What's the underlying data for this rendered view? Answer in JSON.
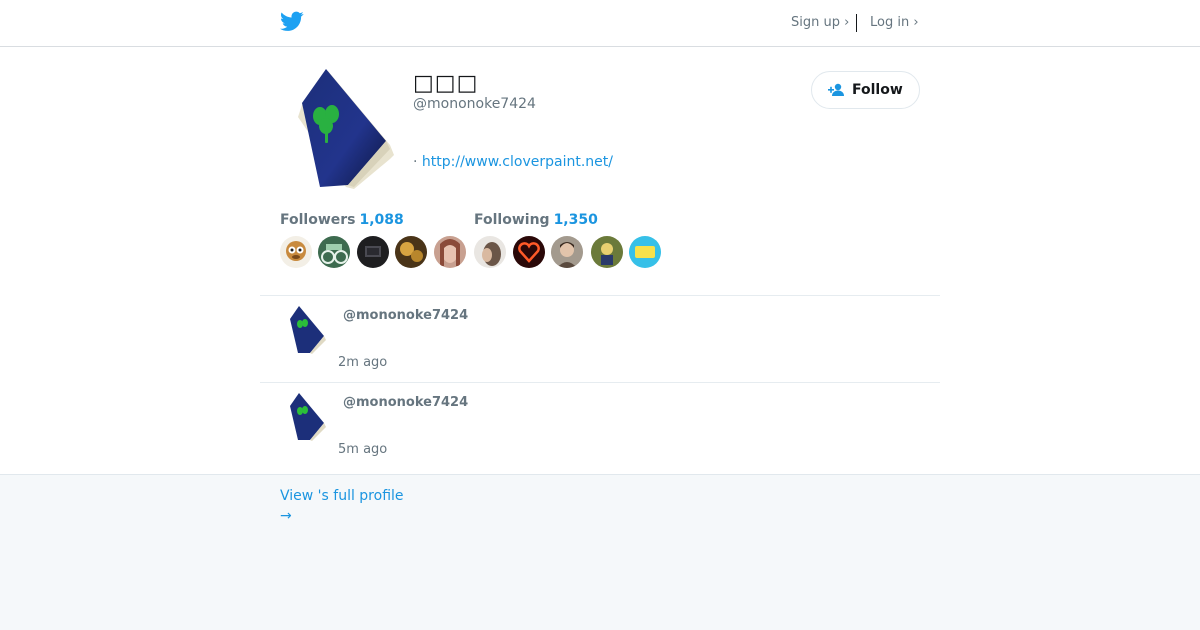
{
  "header": {
    "signup_label": "Sign up ›",
    "login_label": "Log in ›"
  },
  "profile": {
    "name": "□□□",
    "handle": "@mononoke7424",
    "bullet": "·",
    "url": "http://www.cloverpaint.net/",
    "follow_label": "Follow"
  },
  "stats": {
    "followers_label": "Followers",
    "followers_count": "1,088",
    "following_label": "Following",
    "following_count": "1,350"
  },
  "tweets": [
    {
      "handle": "@mononoke7424",
      "time": "2m ago"
    },
    {
      "handle": "@mononoke7424",
      "time": "5m ago"
    }
  ],
  "footer": {
    "view_profile_label": "View 's full profile",
    "arrow": "→"
  },
  "colors": {
    "link": "#1b95e0",
    "brand": "#1da1f2",
    "muted": "#66757f"
  }
}
